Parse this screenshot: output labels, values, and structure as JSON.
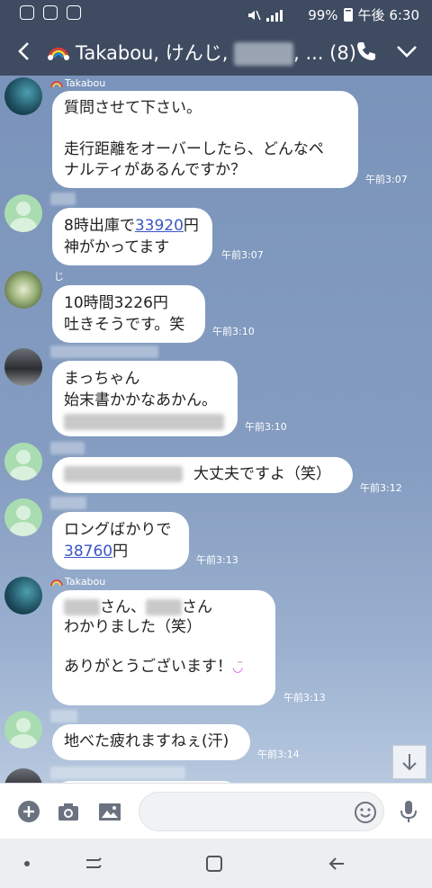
{
  "status_bar": {
    "battery": "99%",
    "time": "午後 6:30"
  },
  "header": {
    "title_prefix": "Takabou, けんじ,",
    "title_suffix": ", ... (8)",
    "icons": [
      "back-icon",
      "rainbow-icon",
      "phone-icon",
      "chevron-down-icon"
    ]
  },
  "messages": [
    {
      "sender": "Takabou",
      "text": "質問させて下さい。\n\n走行距離をオーバーしたら、どんなペ\nナルティがあるんですか？",
      "time": "午前3:07"
    },
    {
      "sender": "",
      "text_before": "8時出庫で",
      "link": "33920",
      "text_after": "円\n神がかってます",
      "time": "午前3:07"
    },
    {
      "sender": "じ",
      "text": "10時間3226円\n吐きそうです。笑",
      "time": "午前3:10"
    },
    {
      "sender": "",
      "text": "まっちゃん\n始末書かかなあかん。",
      "time": "午前3:10"
    },
    {
      "sender": "",
      "text": "大丈夫ですよ（笑）",
      "time": "午前3:12"
    },
    {
      "sender": "",
      "text_before": "ロングばかりで\n",
      "link": "38760",
      "text_after": "円",
      "time": "午前3:13"
    },
    {
      "sender": "Takabou",
      "line1_a": "さん、",
      "line1_b": "さん",
      "text": "わかりました（笑）\n\nありがとうございます！",
      "time": "午前3:13"
    },
    {
      "sender": "",
      "text": "地べた疲れますねぇ(汗)",
      "time": "午前3:14"
    }
  ],
  "input": {
    "placeholder": ""
  },
  "colors": {
    "header": "#3e4b61",
    "chat_bg": "#7f98bd",
    "bubble": "#ffffff",
    "link": "#3a55c8"
  }
}
